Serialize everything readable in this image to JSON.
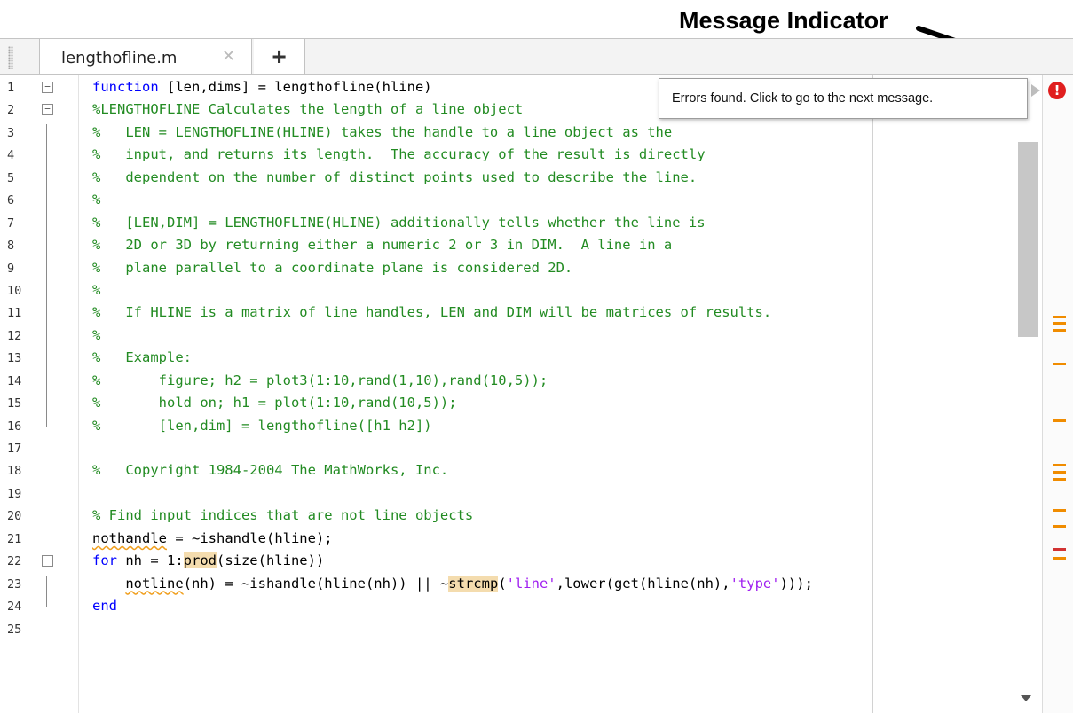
{
  "annotation": {
    "label": "Message Indicator"
  },
  "tabs": [
    {
      "label": "lengthofline.m",
      "close_glyph": "⌘"
    }
  ],
  "tab_add_label": "+",
  "tooltip": {
    "text": "Errors found. Click to go to the next message."
  },
  "error_indicator": {
    "glyph": "!",
    "color": "#e01e1e"
  },
  "colors": {
    "keyword": "#0000ff",
    "comment": "#228b22",
    "string": "#a020f0",
    "warning": "#f08c00",
    "error": "#d23232"
  },
  "code_lines": [
    {
      "num": "1",
      "text": "function [len,dims] = lengthofline(hline)"
    },
    {
      "num": "2",
      "text": "%LENGTHOFLINE Calculates the length of a line object"
    },
    {
      "num": "3",
      "text": "%   LEN = LENGTHOFLINE(HLINE) takes the handle to a line object as the"
    },
    {
      "num": "4",
      "text": "%   input, and returns its length.  The accuracy of the result is directly"
    },
    {
      "num": "5",
      "text": "%   dependent on the number of distinct points used to describe the line."
    },
    {
      "num": "6",
      "text": "%"
    },
    {
      "num": "7",
      "text": "%   [LEN,DIM] = LENGTHOFLINE(HLINE) additionally tells whether the line is"
    },
    {
      "num": "8",
      "text": "%   2D or 3D by returning either a numeric 2 or 3 in DIM.  A line in a"
    },
    {
      "num": "9",
      "text": "%   plane parallel to a coordinate plane is considered 2D."
    },
    {
      "num": "10",
      "text": "%"
    },
    {
      "num": "11",
      "text": "%   If HLINE is a matrix of line handles, LEN and DIM will be matrices of results."
    },
    {
      "num": "12",
      "text": "%"
    },
    {
      "num": "13",
      "text": "%   Example:"
    },
    {
      "num": "14",
      "text": "%       figure; h2 = plot3(1:10,rand(1,10),rand(10,5));"
    },
    {
      "num": "15",
      "text": "%       hold on; h1 = plot(1:10,rand(10,5));"
    },
    {
      "num": "16",
      "text": "%       [len,dim] = lengthofline([h1 h2])"
    },
    {
      "num": "17",
      "text": ""
    },
    {
      "num": "18",
      "text": "%   Copyright 1984-2004 The MathWorks, Inc."
    },
    {
      "num": "19",
      "text": ""
    },
    {
      "num": "20",
      "text": "% Find input indices that are not line objects"
    },
    {
      "num": "21",
      "parts": [
        "nothandle",
        " = ~ishandle(hline);"
      ]
    },
    {
      "num": "22",
      "parts": [
        "for",
        " nh = 1:",
        "prod",
        "(size(hline))"
      ]
    },
    {
      "num": "23",
      "parts": [
        "    ",
        "notline",
        "(nh) = ~ishandle(hline(nh)) || ~",
        "strcmp",
        "(",
        "'line'",
        ",lower(get(hline(nh),",
        "'type'",
        ")));"
      ]
    },
    {
      "num": "24",
      "text": "end"
    },
    {
      "num": "25",
      "text": ""
    }
  ],
  "message_marks": [
    {
      "line": 11,
      "type": "warning"
    },
    {
      "line": 11.3,
      "type": "warning"
    },
    {
      "line": 11.6,
      "type": "warning"
    },
    {
      "line": 13.1,
      "type": "warning"
    },
    {
      "line": 15.6,
      "type": "warning"
    },
    {
      "line": 17.6,
      "type": "warning"
    },
    {
      "line": 17.9,
      "type": "warning"
    },
    {
      "line": 18.2,
      "type": "warning"
    },
    {
      "line": 19.6,
      "type": "warning"
    },
    {
      "line": 20.3,
      "type": "warning"
    },
    {
      "line": 21.3,
      "type": "error"
    },
    {
      "line": 21.7,
      "type": "warning"
    }
  ]
}
